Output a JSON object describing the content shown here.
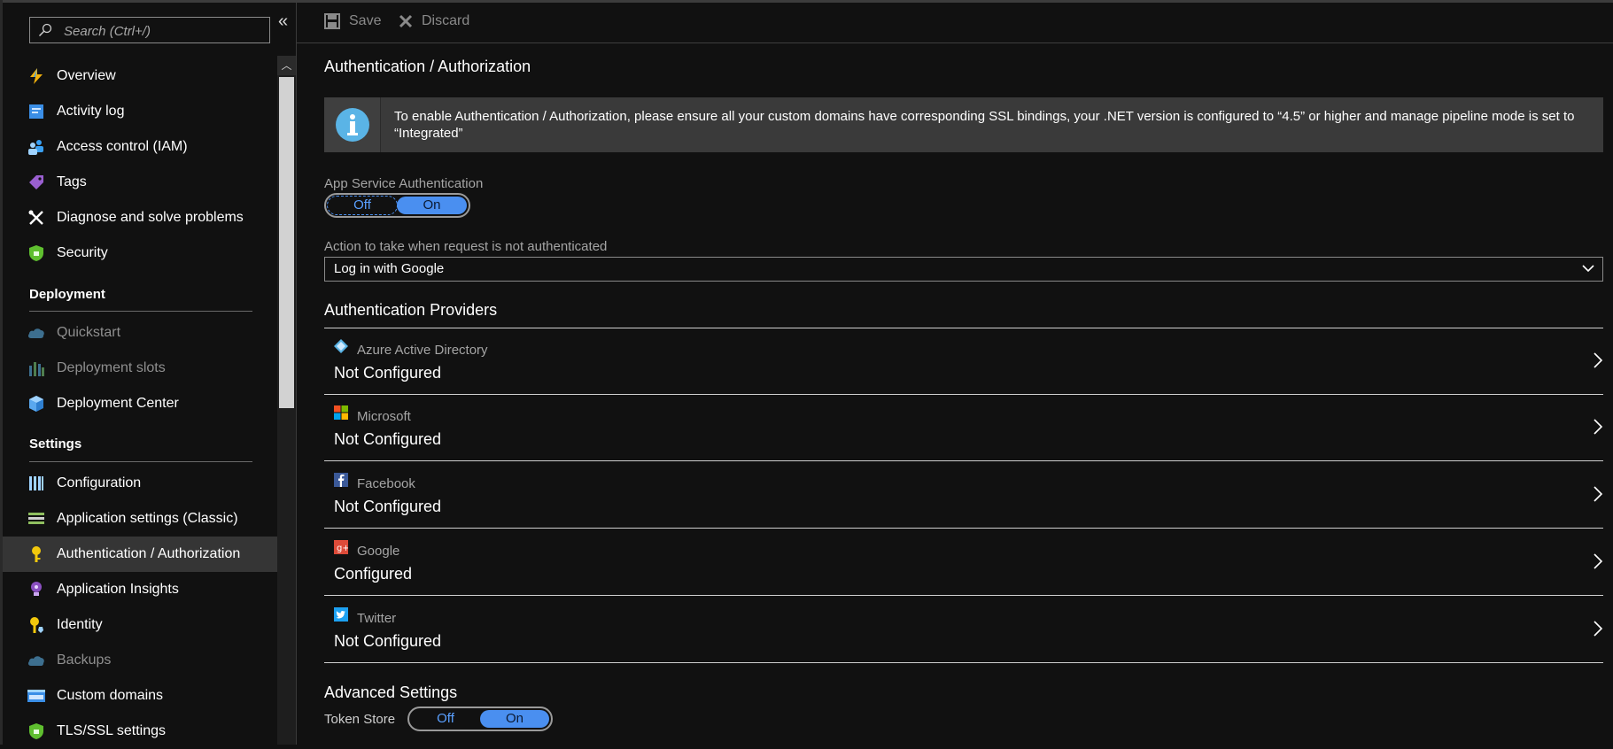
{
  "sidebar": {
    "search_placeholder": "Search (Ctrl+/)",
    "collapse_label": "«",
    "items_top": [
      {
        "label": "Overview",
        "icon": "lightning-bolt-icon"
      },
      {
        "label": "Activity log",
        "icon": "activity-log-icon"
      },
      {
        "label": "Access control (IAM)",
        "icon": "people-icon"
      },
      {
        "label": "Tags",
        "icon": "tag-icon"
      },
      {
        "label": "Diagnose and solve problems",
        "icon": "wrench-icon"
      },
      {
        "label": "Security",
        "icon": "shield-icon"
      }
    ],
    "deployment_header": "Deployment",
    "deployment_items": [
      {
        "label": "Quickstart",
        "icon": "cloud-icon",
        "disabled": true
      },
      {
        "label": "Deployment slots",
        "icon": "slots-icon",
        "disabled": true
      },
      {
        "label": "Deployment Center",
        "icon": "cube-icon",
        "disabled": false
      }
    ],
    "settings_header": "Settings",
    "settings_items": [
      {
        "label": "Configuration",
        "icon": "bars-icon",
        "disabled": false
      },
      {
        "label": "Application settings (Classic)",
        "icon": "settings-list-icon",
        "disabled": false
      },
      {
        "label": "Authentication / Authorization",
        "icon": "key-icon",
        "disabled": false,
        "active": true
      },
      {
        "label": "Application Insights",
        "icon": "lightbulb-icon",
        "disabled": false
      },
      {
        "label": "Identity",
        "icon": "identity-key-icon",
        "disabled": false
      },
      {
        "label": "Backups",
        "icon": "cloud-backup-icon",
        "disabled": true
      },
      {
        "label": "Custom domains",
        "icon": "www-icon",
        "disabled": false
      },
      {
        "label": "TLS/SSL settings",
        "icon": "shield-lock-icon",
        "disabled": false
      }
    ]
  },
  "toolbar": {
    "save_label": "Save",
    "discard_label": "Discard"
  },
  "page": {
    "title": "Authentication / Authorization",
    "info_text": "To enable Authentication / Authorization, please ensure all your custom domains have corresponding SSL bindings, your .NET version is configured to “4.5” or higher and manage pipeline mode is set to “Integrated”",
    "app_service_auth": {
      "label": "App Service Authentication",
      "off": "Off",
      "on": "On",
      "selected": "On"
    },
    "action": {
      "label": "Action to take when request is not authenticated",
      "value": "Log in with Google"
    },
    "providers_header": "Authentication Providers",
    "providers": [
      {
        "name": "Azure Active Directory",
        "status": "Not Configured",
        "icon": "azure-ad-icon"
      },
      {
        "name": "Microsoft",
        "status": "Not Configured",
        "icon": "microsoft-icon"
      },
      {
        "name": "Facebook",
        "status": "Not Configured",
        "icon": "facebook-icon"
      },
      {
        "name": "Google",
        "status": "Configured",
        "icon": "google-icon"
      },
      {
        "name": "Twitter",
        "status": "Not Configured",
        "icon": "twitter-icon"
      }
    ],
    "advanced_header": "Advanced Settings",
    "token_store": {
      "label": "Token Store",
      "off": "Off",
      "on": "On",
      "selected": "On"
    }
  },
  "colors": {
    "accent": "#4a8ff0",
    "active_bg": "#353535",
    "background": "#111111"
  }
}
